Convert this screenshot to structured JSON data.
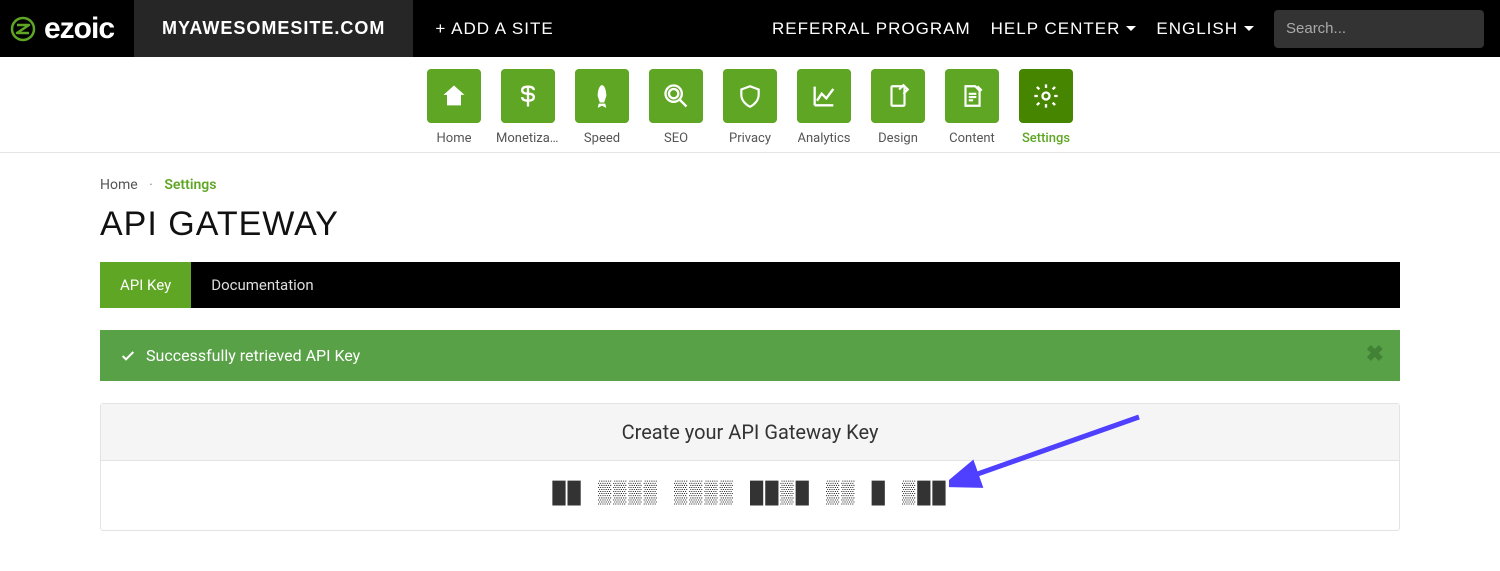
{
  "brand": {
    "name": "ezoic"
  },
  "topbar": {
    "site_tab": "MYAWESOMESITE.COM",
    "add_site": "+ ADD A SITE",
    "links": {
      "referral": "REFERRAL PROGRAM",
      "help": "HELP CENTER",
      "language": "ENGLISH"
    },
    "search_placeholder": "Search..."
  },
  "nav_tiles": [
    {
      "id": "home",
      "label": "Home",
      "icon": "home-icon"
    },
    {
      "id": "monet",
      "label": "Monetiza...",
      "icon": "dollar-icon"
    },
    {
      "id": "speed",
      "label": "Speed",
      "icon": "rocket-icon"
    },
    {
      "id": "seo",
      "label": "SEO",
      "icon": "magnify-icon"
    },
    {
      "id": "privacy",
      "label": "Privacy",
      "icon": "shield-icon"
    },
    {
      "id": "analytics",
      "label": "Analytics",
      "icon": "chart-icon"
    },
    {
      "id": "design",
      "label": "Design",
      "icon": "device-icon"
    },
    {
      "id": "content",
      "label": "Content",
      "icon": "doc-icon"
    },
    {
      "id": "settings",
      "label": "Settings",
      "icon": "gear-icon",
      "active": true
    }
  ],
  "breadcrumb": {
    "home": "Home",
    "sep": "·",
    "current": "Settings"
  },
  "page": {
    "title": "API GATEWAY"
  },
  "tabs": {
    "apikey": "API Key",
    "docs": "Documentation"
  },
  "alert": {
    "message": "Successfully retrieved API Key"
  },
  "panel": {
    "header": "Create your API Gateway Key",
    "key_masked": "██ ▒▒▒▒ ▒▒▒▒ ██▒█ ▒▒ █ ▒██"
  }
}
